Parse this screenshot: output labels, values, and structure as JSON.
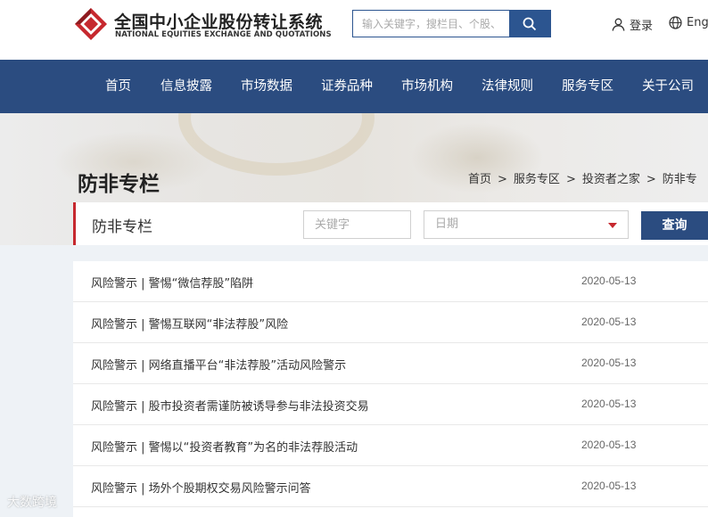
{
  "header": {
    "logo_cn": "全国中小企业股份转让系统",
    "logo_en": "NATIONAL EQUITIES EXCHANGE AND QUOTATIONS",
    "search_placeholder": "输入关键字，搜栏目、个股、",
    "search_icon": "search-icon",
    "login_label": "登录",
    "lang_label": "Eng"
  },
  "nav": {
    "items": [
      "首页",
      "信息披露",
      "市场数据",
      "证券品种",
      "市场机构",
      "法律规则",
      "服务专区",
      "关于公司"
    ]
  },
  "banner": {
    "heading": "防非专栏",
    "breadcrumb": [
      "首页",
      "服务专区",
      "投资者之家",
      "防非专"
    ]
  },
  "filter": {
    "title": "防非专栏",
    "keyword_placeholder": "关键字",
    "date_placeholder": "日期",
    "query_label": "查询",
    "accent_color": "#c6282e",
    "brand_color": "#2b4c80"
  },
  "articles": [
    {
      "title": "风险警示 | 警惕“微信荐股”陷阱",
      "date": "2020-05-13"
    },
    {
      "title": "风险警示 | 警惕互联网“非法荐股”风险",
      "date": "2020-05-13"
    },
    {
      "title": "风险警示 | 网络直播平台“非法荐股”活动风险警示",
      "date": "2020-05-13"
    },
    {
      "title": "风险警示 | 股市投资者需谨防被诱导参与非法投资交易",
      "date": "2020-05-13"
    },
    {
      "title": "风险警示 | 警惕以“投资者教育”为名的非法荐股活动",
      "date": "2020-05-13"
    },
    {
      "title": "风险警示 | 场外个股期权交易风险警示问答",
      "date": "2020-05-13"
    }
  ],
  "watermark": "大数跨境"
}
